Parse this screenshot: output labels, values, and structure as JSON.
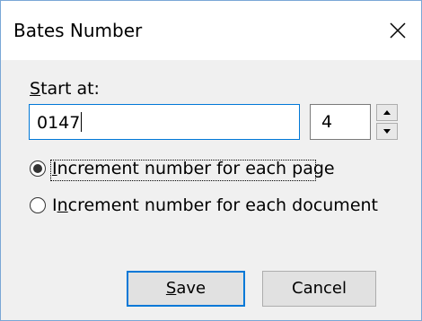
{
  "window": {
    "title": "Bates Number",
    "close_icon": "close-icon"
  },
  "form": {
    "start_label_prefix": "",
    "start_label_access": "S",
    "start_label_rest": "tart at:",
    "start_value": "0147",
    "digits_value": "4",
    "spin_up_icon": "chevron-up-icon",
    "spin_down_icon": "chevron-down-icon"
  },
  "options": [
    {
      "access": "I",
      "rest": "ncrement number for each page",
      "selected": true
    },
    {
      "pre": "I",
      "access": "n",
      "rest": "crement number for each document",
      "selected": false
    }
  ],
  "buttons": {
    "save_access": "S",
    "save_rest": "ave",
    "cancel_label": "Cancel"
  },
  "colors": {
    "accent": "#0078d7",
    "dialog_bg": "#f0f0f0",
    "border": "#7aa7d6"
  }
}
